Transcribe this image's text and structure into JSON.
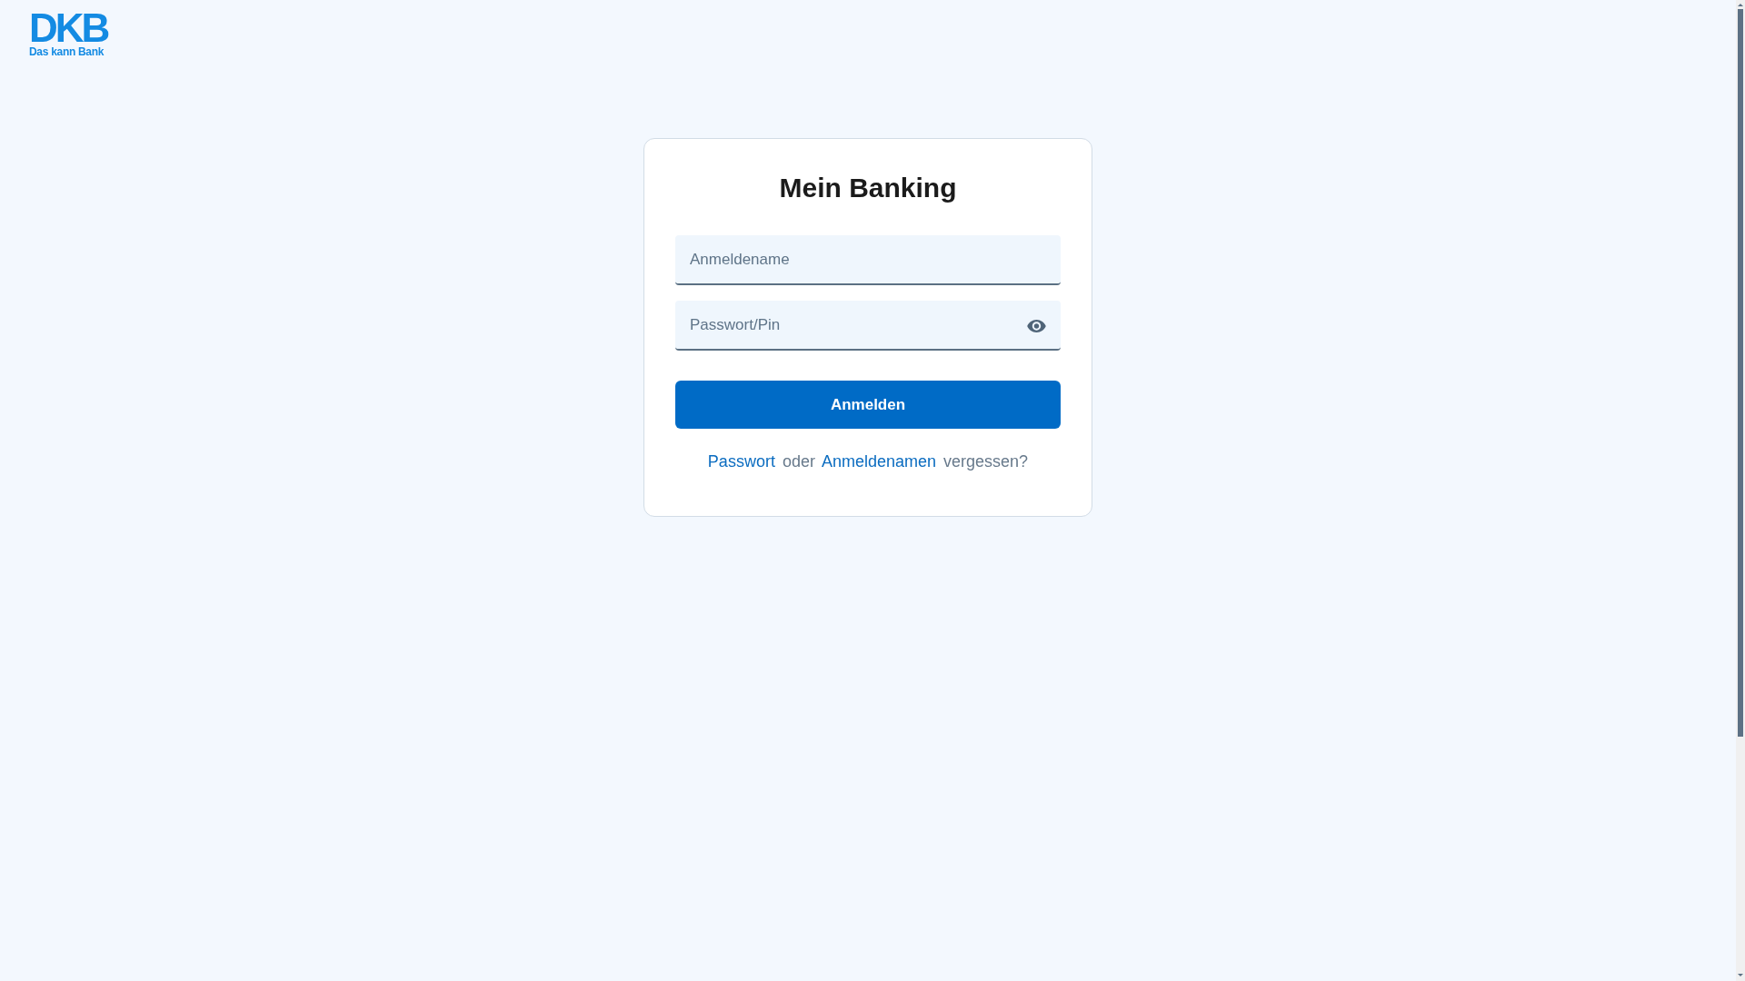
{
  "logo": {
    "wordmark": "DKB",
    "tagline": "Das kann Bank"
  },
  "login_card": {
    "title": "Mein Banking",
    "fields": [
      {
        "kind": "text",
        "placeholder": "Anmeldename"
      },
      {
        "kind": "password",
        "placeholder": "Passwort/Pin"
      }
    ],
    "submit_button": "Anmelden",
    "help_text": [
      {
        "kind": "link",
        "text": "Passwort"
      },
      {
        "kind": "text",
        "text": "oder"
      },
      {
        "kind": "link",
        "text": "Anmeldenamen"
      },
      {
        "kind": "text",
        "text": "vergessen?"
      }
    ]
  }
}
